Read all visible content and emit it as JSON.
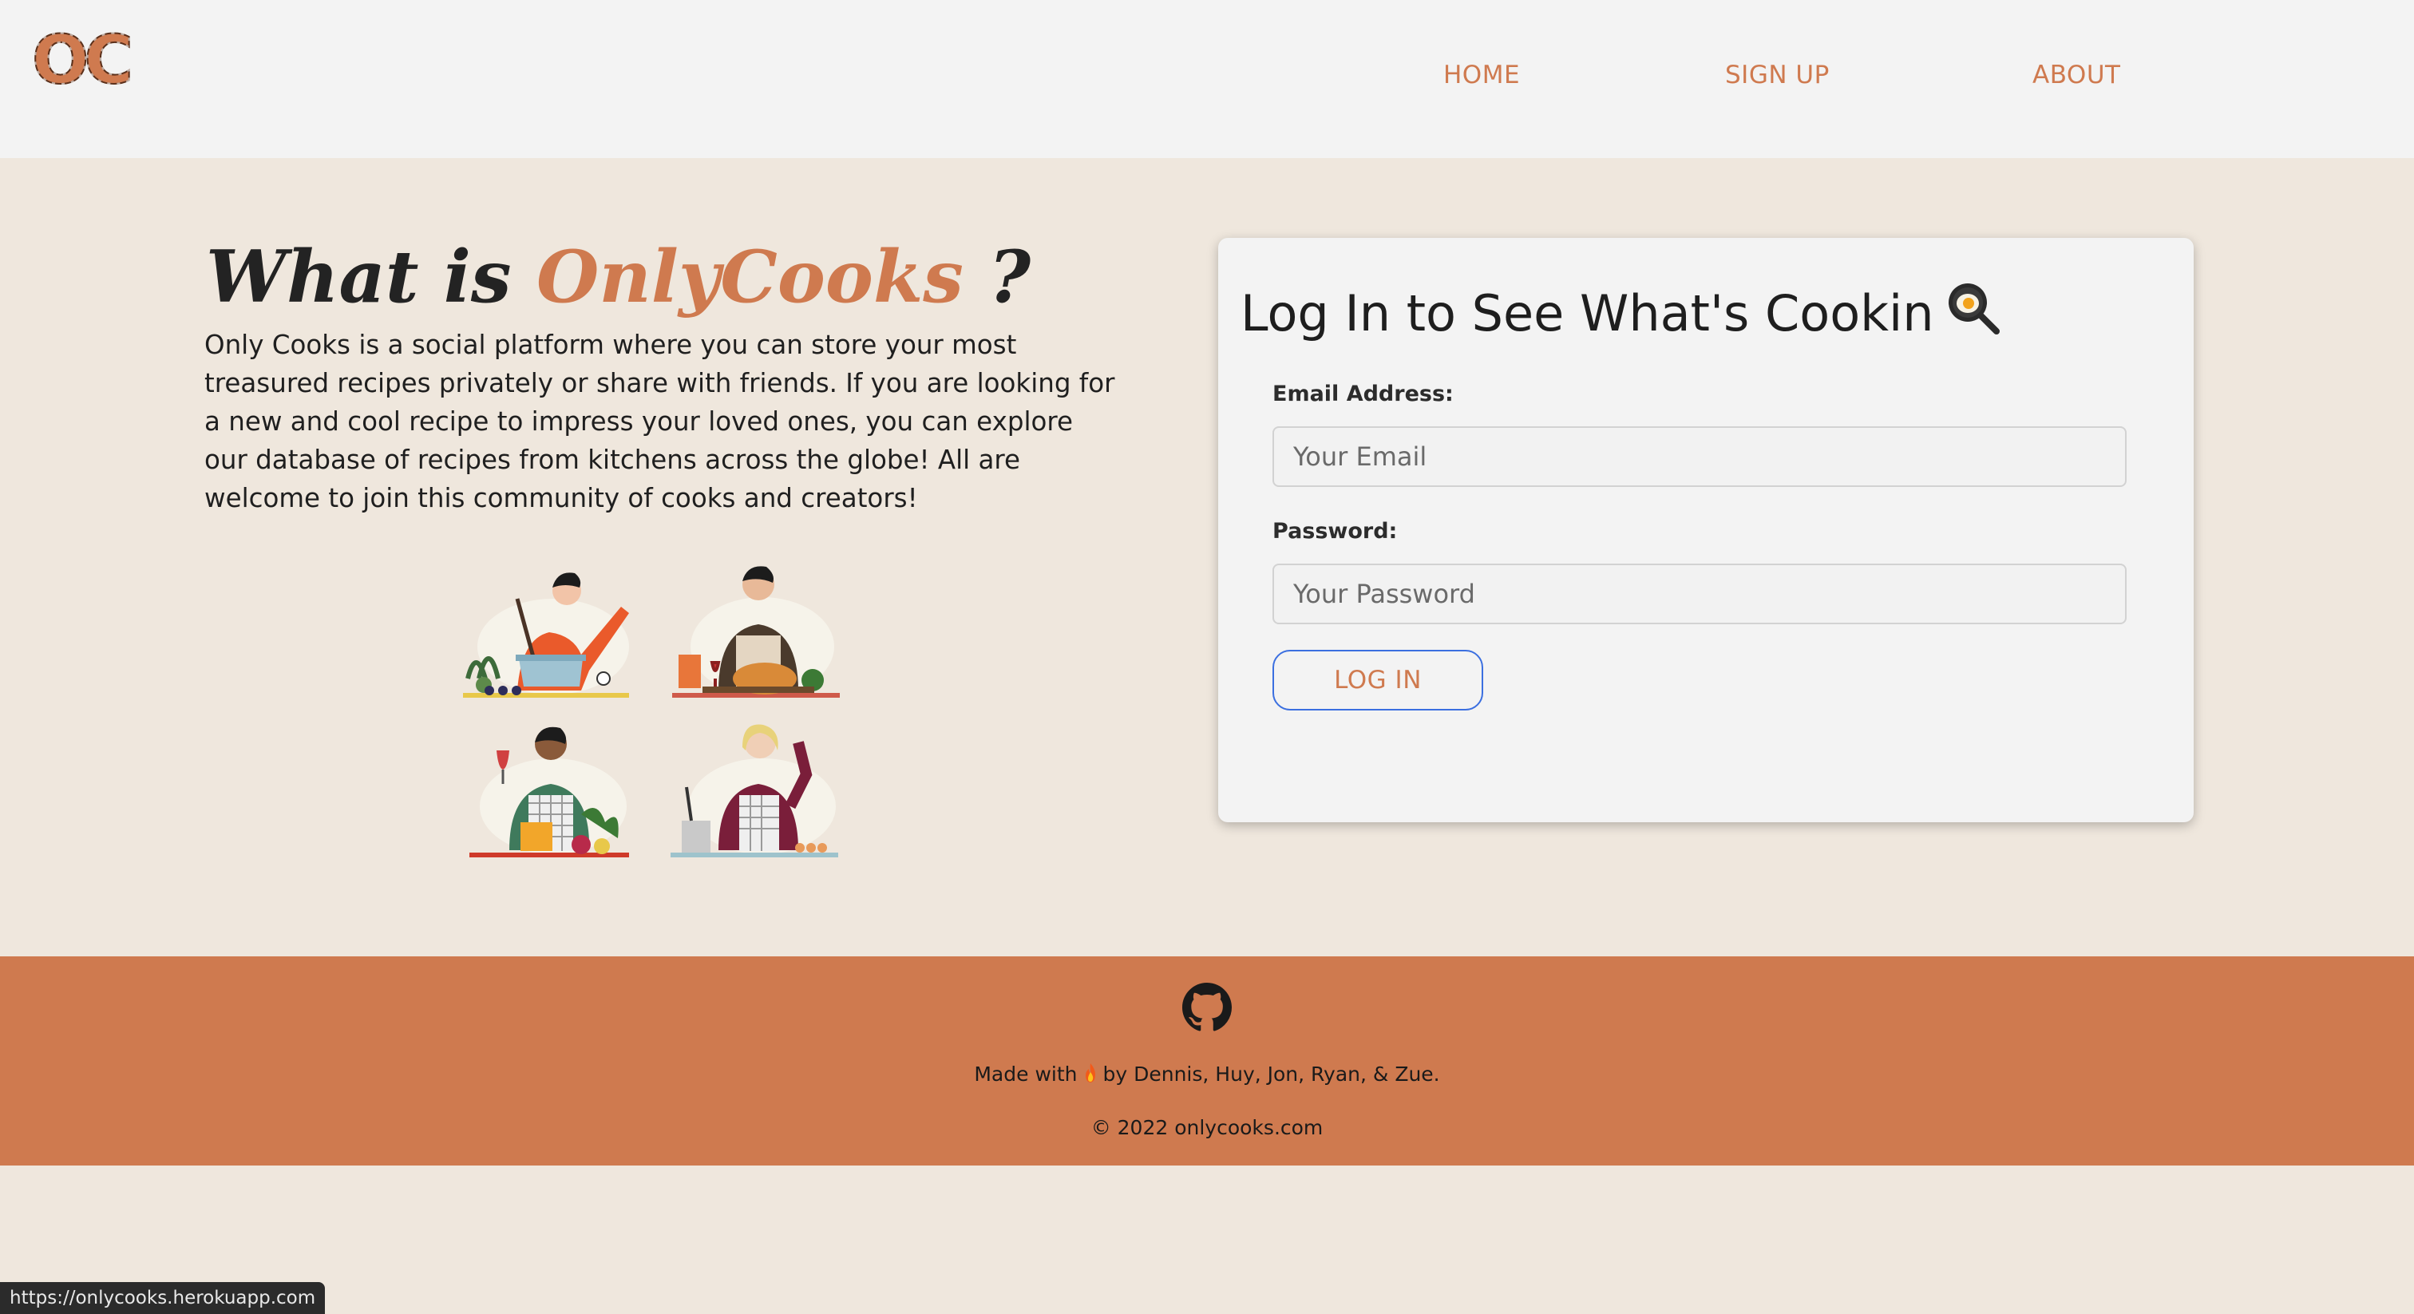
{
  "navbar": {
    "logo_text": "OC",
    "links": [
      {
        "label": "HOME"
      },
      {
        "label": "SIGN UP"
      },
      {
        "label": "ABOUT"
      }
    ]
  },
  "intro": {
    "title_prefix": "What is",
    "title_brand": "OnlyCooks",
    "title_suffix": "?",
    "description": "Only Cooks is a social platform where you can store your most treasured recipes privately or share with friends. If you are looking for a new and cool recipe to impress your loved ones, you can explore our database of recipes from kitchens across the globe! All are welcome to join this community of cooks and creators!"
  },
  "login": {
    "title": "Log In to See What's Cookin",
    "title_icon": "frying-pan-egg-icon",
    "email_label": "Email Address:",
    "email_placeholder": "Your Email",
    "password_label": "Password:",
    "password_placeholder": "Your Password",
    "button_label": "LOG IN"
  },
  "footer": {
    "icon": "github-icon",
    "made_with_prefix": "Made with",
    "made_with_icon": "fire-icon",
    "made_with_suffix": "by Dennis, Huy, Jon, Ryan, & Zue.",
    "copyright": "© 2022 onlycooks.com"
  },
  "status_bar": {
    "url": "https://onlycooks.herokuapp.com"
  },
  "colors": {
    "accent": "#cf7a4f",
    "page_bg": "#efe7dd",
    "nav_bg": "#f3f3f3",
    "button_border": "#3b6fe0"
  }
}
